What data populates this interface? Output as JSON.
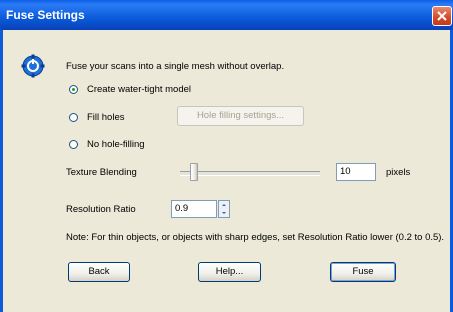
{
  "window": {
    "title": "Fuse Settings"
  },
  "intro": "Fuse your scans into a single mesh without overlap.",
  "options": [
    {
      "label": "Create water-tight model",
      "checked": true
    },
    {
      "label": "Fill holes",
      "checked": false
    },
    {
      "label": "No hole-filling",
      "checked": false
    }
  ],
  "hole_settings_button": "Hole filling settings...",
  "texture": {
    "label": "Texture Blending",
    "value": "10",
    "unit": "pixels",
    "slider_fraction": 0.07
  },
  "resolution": {
    "label": "Resolution Ratio",
    "value": "0.9"
  },
  "note": "Note:  For thin objects, or objects with sharp edges, set Resolution Ratio lower (0.2 to 0.5).",
  "buttons": {
    "back": "Back",
    "help": "Help...",
    "fuse": "Fuse"
  },
  "colors": {
    "title_bar": "#0B5BDA",
    "close_button": "#D2492A",
    "dialog_bg": "#ECE9D8"
  }
}
